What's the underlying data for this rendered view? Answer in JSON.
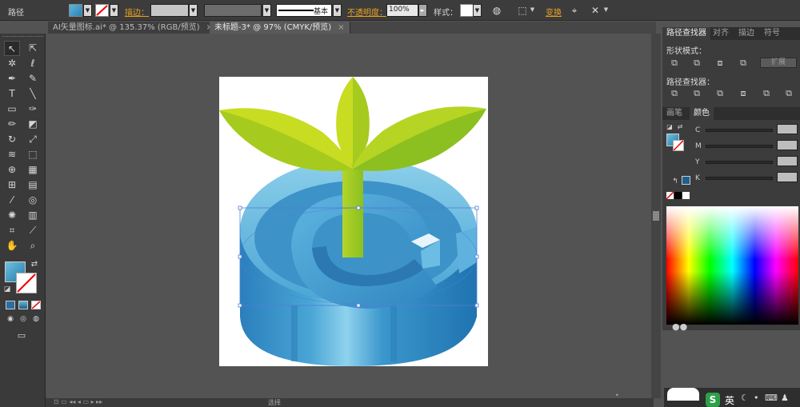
{
  "controlbar": {
    "object_type": "路径",
    "stroke_label": "描边：",
    "opacity_label": "不透明度：",
    "opacity_value": "100%",
    "style_label": "样式：",
    "stroke_profile": "基本",
    "transform_label": "变换"
  },
  "tabs": [
    {
      "label": "AI矢量图标.ai* @ 135.37% (RGB/预览)",
      "active": false
    },
    {
      "label": "未标题-3* @ 97% (CMYK/预览)",
      "active": true
    }
  ],
  "pathfinder_panel": {
    "tabs": [
      "路径查找器",
      "对齐",
      "描边",
      "符号"
    ],
    "shape_modes_label": "形状模式：",
    "expand_button": "扩展",
    "pathfinders_label": "路径查找器："
  },
  "color_panel": {
    "tabs": [
      "画笔",
      "颜色"
    ],
    "channels": [
      "C",
      "M",
      "Y",
      "K"
    ]
  },
  "statusbar": {
    "tool_name": "选择"
  },
  "taskbar": {
    "ime_label": "英"
  },
  "colors": {
    "fill": "#3aa0cc",
    "leaf_light": "#c8dc22",
    "leaf_dark": "#8cc020",
    "accent_orange": "#e8a020"
  }
}
